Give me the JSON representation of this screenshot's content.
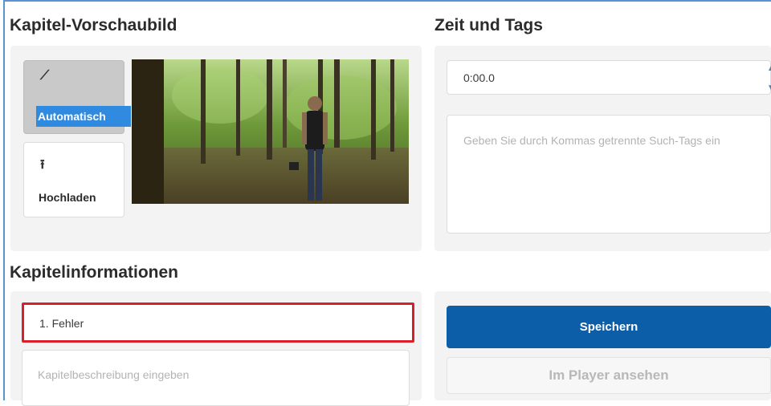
{
  "thumbnail_section": {
    "title": "Kapitel-Vorschaubild",
    "auto_button": {
      "label": "Automatisch",
      "icon": "magic-wand-icon"
    },
    "upload_button": {
      "label": "Hochladen",
      "icon": "upload-icon"
    }
  },
  "time_tags_section": {
    "title": "Zeit und Tags",
    "time_value": "0:00.0",
    "tags_placeholder": "Geben Sie durch Kommas getrennte Such-Tags ein"
  },
  "chapter_info_section": {
    "title": "Kapitelinformationen",
    "chapter_title_value": "1. Fehler",
    "description_placeholder": "Kapitelbeschreibung eingeben"
  },
  "actions": {
    "save_label": "Speichern",
    "view_in_player_label": "Im Player ansehen"
  },
  "colors": {
    "primary_button": "#0d5ea8",
    "auto_highlight": "#2f8ae0",
    "selected_field_border": "#d9202a"
  }
}
